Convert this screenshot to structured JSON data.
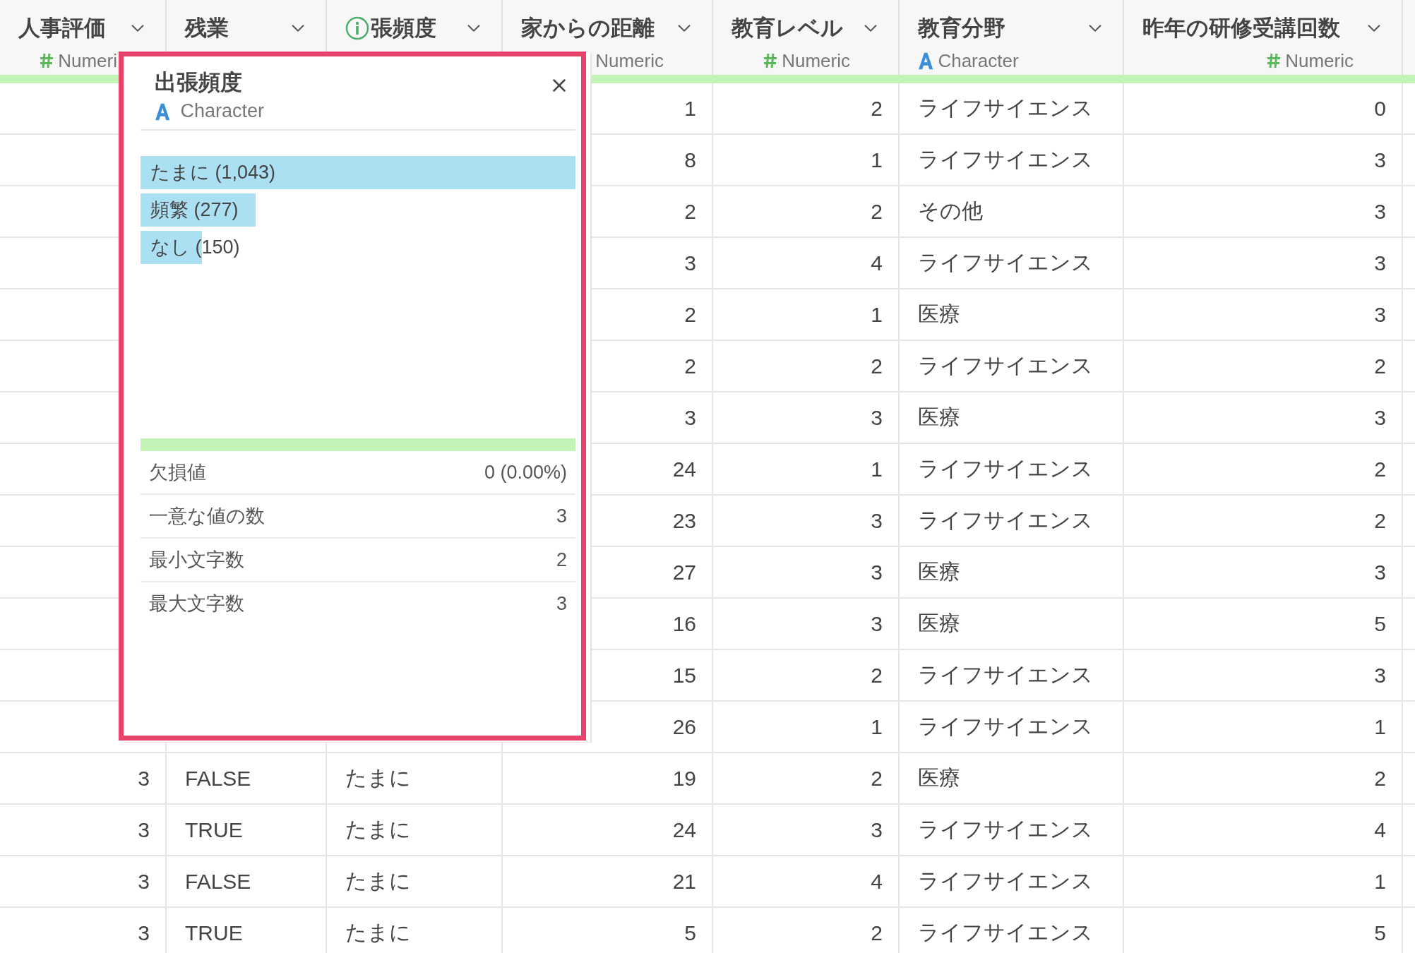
{
  "columns": [
    {
      "name": "人事評価",
      "kind": "numeric",
      "info_icon": false,
      "type_icon": true,
      "type_label": "Numeri"
    },
    {
      "name": "残業",
      "kind": "logical",
      "info_icon": false
    },
    {
      "name": "張頻度",
      "kind": "character",
      "info_icon": true
    },
    {
      "name": "家からの距離",
      "kind": "numeric",
      "info_icon": false,
      "type_label": "Numeric"
    },
    {
      "name": "教育レベル",
      "kind": "numeric",
      "info_icon": false,
      "type_icon": true,
      "type_label": "Numeric"
    },
    {
      "name": "教育分野",
      "kind": "character",
      "info_icon": false,
      "type_icon": true,
      "type_label": "Character"
    },
    {
      "name": "昨年の研修受講回数",
      "kind": "numeric",
      "info_icon": false,
      "type_icon": true,
      "type_label": "Numeric"
    }
  ],
  "rows": [
    {
      "cells": [
        "1",
        "2",
        "ライフサイエンス",
        "0"
      ]
    },
    {
      "cells": [
        "8",
        "1",
        "ライフサイエンス",
        "3"
      ]
    },
    {
      "cells": [
        "2",
        "2",
        "その他",
        "3"
      ]
    },
    {
      "cells": [
        "3",
        "4",
        "ライフサイエンス",
        "3"
      ]
    },
    {
      "cells": [
        "2",
        "1",
        "医療",
        "3"
      ]
    },
    {
      "cells": [
        "2",
        "2",
        "ライフサイエンス",
        "2"
      ]
    },
    {
      "cells": [
        "3",
        "3",
        "医療",
        "3"
      ]
    },
    {
      "cells": [
        "24",
        "1",
        "ライフサイエンス",
        "2"
      ]
    },
    {
      "cells": [
        "23",
        "3",
        "ライフサイエンス",
        "2"
      ]
    },
    {
      "cells": [
        "27",
        "3",
        "医療",
        "3"
      ]
    },
    {
      "cells": [
        "16",
        "3",
        "医療",
        "5"
      ]
    },
    {
      "cells": [
        "15",
        "2",
        "ライフサイエンス",
        "3"
      ]
    },
    {
      "cells": [
        "26",
        "1",
        "ライフサイエンス",
        "1"
      ]
    },
    {
      "cells": [
        "3",
        "FALSE",
        "たまに",
        "19",
        "2",
        "医療",
        "2"
      ]
    },
    {
      "cells": [
        "3",
        "TRUE",
        "たまに",
        "24",
        "3",
        "ライフサイエンス",
        "4"
      ]
    },
    {
      "cells": [
        "3",
        "FALSE",
        "たまに",
        "21",
        "4",
        "ライフサイエンス",
        "1"
      ]
    },
    {
      "cells": [
        "3",
        "TRUE",
        "たまに",
        "5",
        "2",
        "ライフサイエンス",
        "5"
      ]
    }
  ],
  "popup": {
    "title": "出張頻度",
    "type_label": "Character",
    "bars": [
      {
        "label": "たまに (1,043)",
        "level": 1
      },
      {
        "label": "頻繁 (277)",
        "level": 0.265
      },
      {
        "label": "なし (150)",
        "level": 0.142
      }
    ],
    "valid": {
      "level": 1
    },
    "stats": [
      {
        "label": "欠損値",
        "value": "0 (0.00%)"
      },
      {
        "label": "一意な値の数",
        "value": "3"
      },
      {
        "label": "最小文字数",
        "value": "2"
      },
      {
        "label": "最大文字数",
        "value": "3"
      }
    ]
  }
}
